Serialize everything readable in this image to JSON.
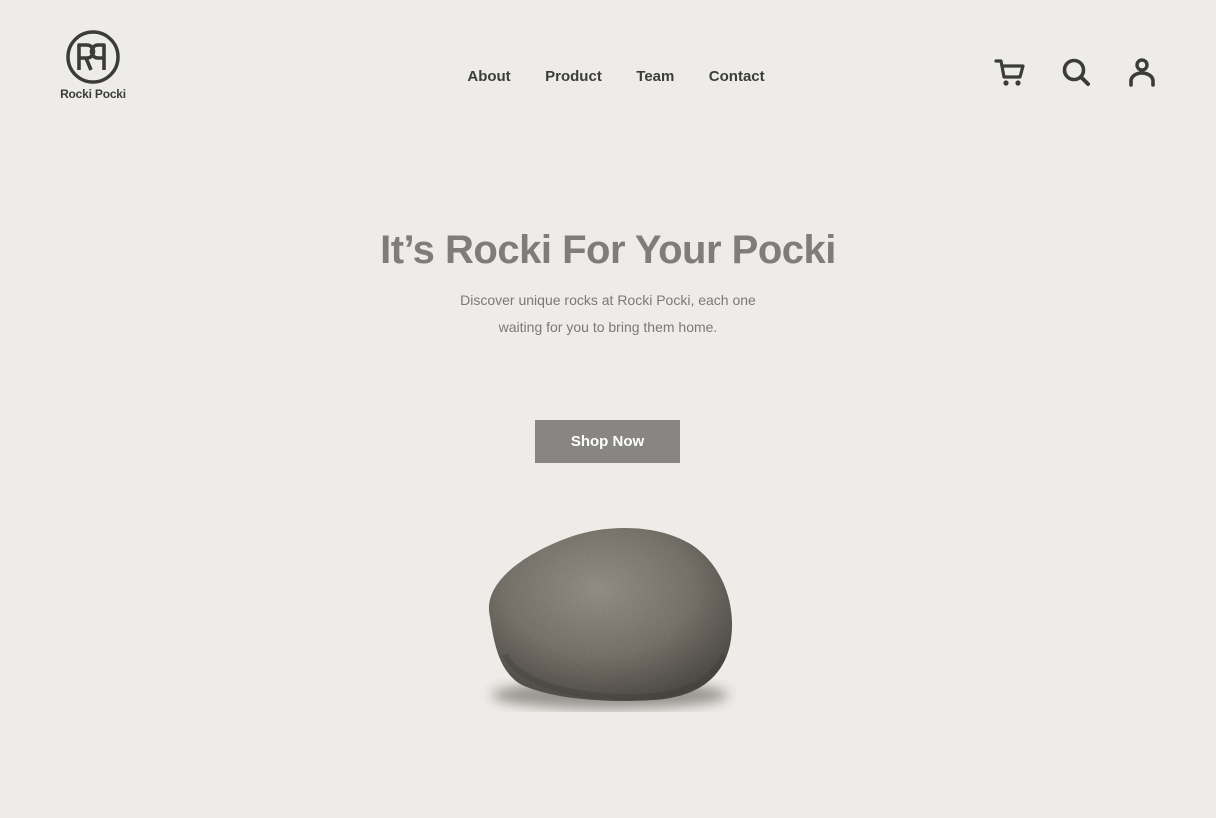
{
  "brand": {
    "name": "Rocki Pocki",
    "monogram": "RP"
  },
  "nav": {
    "items": [
      {
        "label": "About"
      },
      {
        "label": "Product"
      },
      {
        "label": "Team"
      },
      {
        "label": "Contact"
      }
    ]
  },
  "actions": {
    "icons": [
      "cart-icon",
      "search-icon",
      "user-icon"
    ]
  },
  "hero": {
    "title": "It’s Rocki For Your Pocki",
    "subtitle": "Discover unique rocks at Rocki Pocki, each one waiting for you to bring them home.",
    "cta_label": "Shop Now"
  },
  "colors": {
    "background": "#eeece8",
    "text_dark": "#3c3c3c",
    "text_muted": "#7e7d7b",
    "button_bg": "#878683",
    "button_text": "#ffffff"
  }
}
